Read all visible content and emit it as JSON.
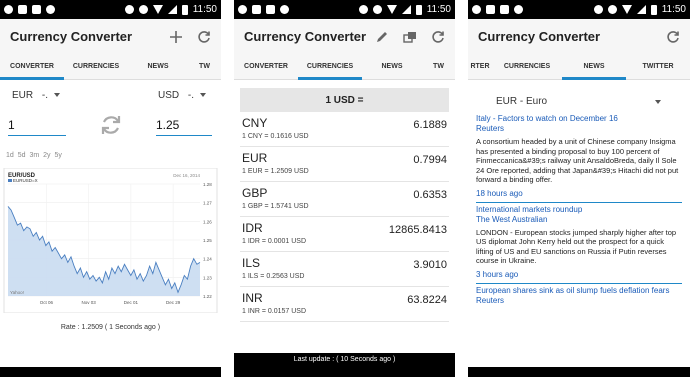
{
  "status_time": "11:50",
  "screens": [
    {
      "title": "Currency Converter",
      "tabs": [
        "CONVERTER",
        "CURRENCIES",
        "NEWS",
        "TW"
      ],
      "active_tab": 0,
      "icons": [
        "add-icon",
        "refresh-icon"
      ],
      "from": {
        "currency": "EUR",
        "suffix": "-.",
        "amount": "1"
      },
      "to": {
        "currency": "USD",
        "suffix": "-.",
        "amount": "1.25"
      },
      "periods": "1d 5d 3m 2y 5y",
      "rate_text": "Rate : 1.2509 ( 1 Seconds ago )"
    },
    {
      "title": "Currency Converter",
      "tabs": [
        "CONVERTER",
        "CURRENCIES",
        "NEWS",
        "TW"
      ],
      "active_tab": 1,
      "icons": [
        "edit-icon",
        "copy-icon",
        "refresh-icon"
      ],
      "base": "1 USD =",
      "rows": [
        {
          "code": "CNY",
          "sub": "1 CNY = 0.1616 USD",
          "value": "6.1889"
        },
        {
          "code": "EUR",
          "sub": "1 EUR = 1.2509 USD",
          "value": "0.7994"
        },
        {
          "code": "GBP",
          "sub": "1 GBP = 1.5741 USD",
          "value": "0.6353"
        },
        {
          "code": "IDR",
          "sub": "1 IDR = 0.0001 USD",
          "value": "12865.8413"
        },
        {
          "code": "ILS",
          "sub": "1 ILS = 0.2563 USD",
          "value": "3.9010"
        },
        {
          "code": "INR",
          "sub": "1 INR = 0.0157 USD",
          "value": "63.8224"
        }
      ],
      "last_update": "Last update : ( 10 Seconds ago )"
    },
    {
      "title": "Currency Converter",
      "tabs": [
        "RTER",
        "CURRENCIES",
        "NEWS",
        "TWITTER"
      ],
      "active_tab": 2,
      "icons": [
        "refresh-icon"
      ],
      "news_currency": "EUR  -  Euro",
      "news": [
        {
          "title": "Italy - Factors to watch on December 16",
          "source": "Reuters",
          "body": "A consortium headed by a unit of Chinese company Insigma has presented a binding proposal to buy 100 percent of Finmeccanica&#39;s railway unit AnsaldoBreda, daily Il Sole 24 Ore reported, adding that Japan&#39;s Hitachi did not put forward a binding offer.",
          "time": "18 hours ago"
        },
        {
          "title": "International markets roundup",
          "source": "The West Australian",
          "body": "LONDON - European stocks jumped sharply higher after top US diplomat John Kerry held out the prospect for a quick lifting of US and EU sanctions on Russia if Putin reverses course in Ukraine.",
          "time": "3 hours ago"
        },
        {
          "title": "European shares sink as oil slump fuels deflation fears",
          "source": "Reuters",
          "body": "",
          "time": ""
        }
      ]
    }
  ],
  "chart": {
    "title": "EUR/USD",
    "legend": "EURUSD=X",
    "date_label": "Dec 16, 2014",
    "y_ticks": [
      "1.28",
      "1.27",
      "1.26",
      "1.25",
      "1.24",
      "1.23",
      "1.22"
    ],
    "x_ticks": [
      "Oct 06",
      "Nov 03",
      "Dec 01",
      "Dec 29"
    ],
    "watermark": "Yahoo!",
    "values": [
      1.268,
      1.266,
      1.262,
      1.258,
      1.259,
      1.255,
      1.257,
      1.256,
      1.252,
      1.254,
      1.25,
      1.252,
      1.247,
      1.249,
      1.244,
      1.246,
      1.243,
      1.24,
      1.242,
      1.238,
      1.241,
      1.236,
      1.232,
      1.235,
      1.23,
      1.233,
      1.229,
      1.231,
      1.228,
      1.23,
      1.227,
      1.233,
      1.229,
      1.235,
      1.232,
      1.236,
      1.233,
      1.237,
      1.234,
      1.231,
      1.234,
      1.229,
      1.232,
      1.228,
      1.231,
      1.236,
      1.232,
      1.238,
      1.234,
      1.23,
      1.226,
      1.229,
      1.224,
      1.227,
      1.222,
      1.226,
      1.231,
      1.229,
      1.236,
      1.24,
      1.237,
      1.238
    ]
  }
}
